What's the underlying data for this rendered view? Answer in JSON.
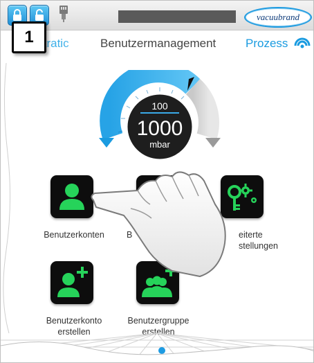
{
  "header": {
    "brand": "vacuubrand"
  },
  "step_badge": "1",
  "tabs": {
    "left": "nistratic",
    "center": "Benutzermanagement",
    "right": "Prozess"
  },
  "gauge": {
    "setpoint": "100",
    "value": "1000",
    "unit": "mbar"
  },
  "tiles": [
    {
      "label_line1": "Benutzerkonten",
      "label_line2": ""
    },
    {
      "label_line1": "B",
      "label_line2": ""
    },
    {
      "label_line1": "eiterte",
      "label_line2": "stellungen"
    },
    {
      "label_line1": "Benutzerkonto",
      "label_line2": "erstellen"
    },
    {
      "label_line1": "Benutzergruppe",
      "label_line2": "erstellen"
    }
  ],
  "colors": {
    "accent": "#1a9be0",
    "icon_green": "#26d35a",
    "tile_bg": "#0d0d0d"
  },
  "icons": {
    "lock_left": "lock-icon",
    "lock_right": "unlock-icon",
    "network": "network-plug-icon",
    "wifi": "signal-icon"
  }
}
